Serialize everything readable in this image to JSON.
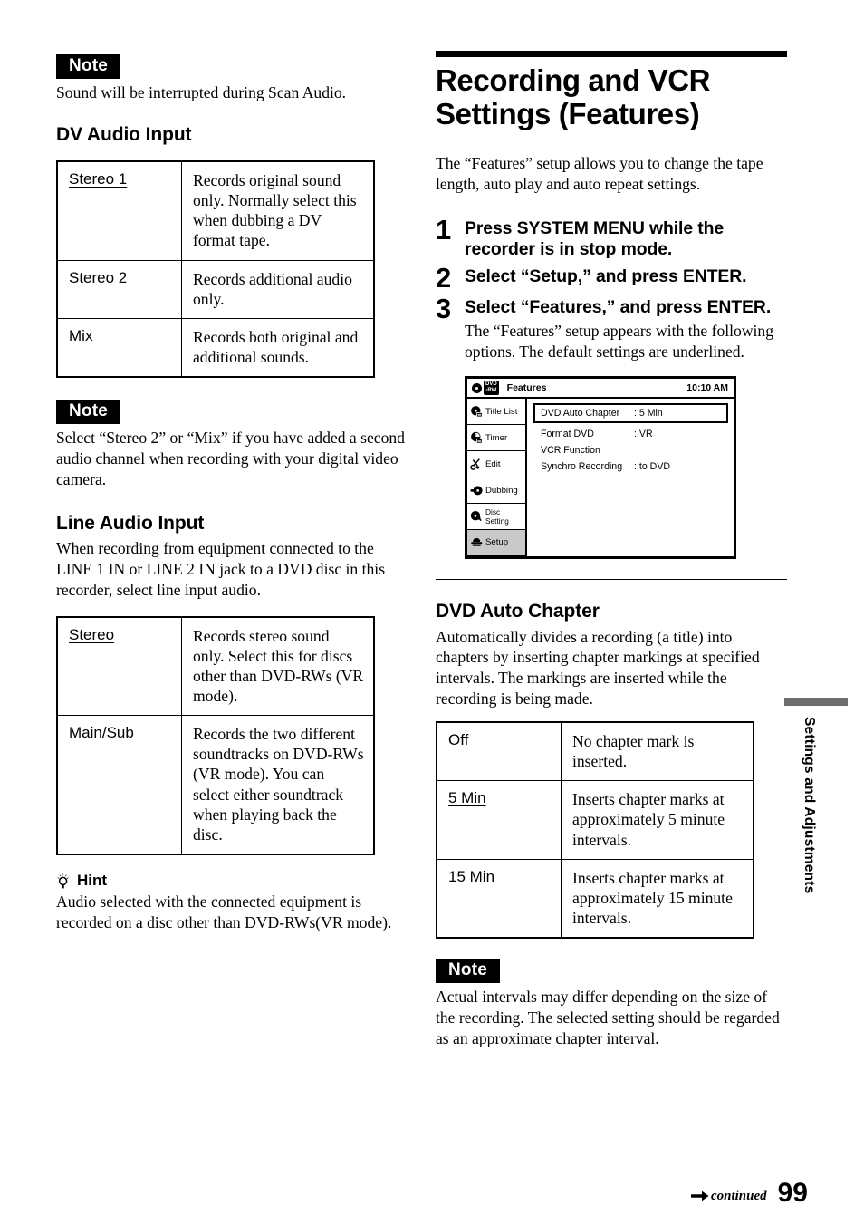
{
  "left": {
    "note1": {
      "badge": "Note",
      "text": "Sound will be interrupted during Scan Audio."
    },
    "dv_audio_input": {
      "heading": "DV Audio Input",
      "rows": [
        {
          "option": "Stereo 1",
          "underlined": true,
          "description": "Records original sound only. Normally select this when dubbing a DV format tape."
        },
        {
          "option": "Stereo 2",
          "underlined": false,
          "description": "Records additional audio only."
        },
        {
          "option": "Mix",
          "underlined": false,
          "description": "Records both original and additional sounds."
        }
      ]
    },
    "note2": {
      "badge": "Note",
      "text": "Select “Stereo 2” or “Mix” if you have added a second audio channel when recording with your digital video camera."
    },
    "line_audio_input": {
      "heading": "Line Audio Input",
      "intro": "When recording from equipment connected to the LINE 1 IN or LINE 2 IN jack to a DVD disc in this recorder, select line input audio.",
      "rows": [
        {
          "option": "Stereo",
          "underlined": true,
          "description": "Records stereo sound only. Select this for discs other than DVD-RWs (VR mode)."
        },
        {
          "option": "Main/Sub",
          "underlined": false,
          "description": "Records the two different soundtracks on DVD-RWs (VR mode). You can select either soundtrack when playing back the disc."
        }
      ]
    },
    "hint": {
      "label": "Hint",
      "text": "Audio selected with the connected equipment is recorded on a disc other than DVD-RWs(VR mode)."
    }
  },
  "right": {
    "title": "Recording and VCR Settings (Features)",
    "intro": "The “Features” setup allows you to change the tape length, auto play and auto repeat settings.",
    "steps": [
      {
        "num": "1",
        "title": "Press SYSTEM MENU while the recorder is in stop mode.",
        "desc": ""
      },
      {
        "num": "2",
        "title": "Select “Setup,” and press ENTER.",
        "desc": ""
      },
      {
        "num": "3",
        "title": "Select “Features,” and press ENTER.",
        "desc": "The “Features” setup appears with the following options. The default settings are underlined."
      }
    ],
    "osd": {
      "disc_badge_line1": "DVD",
      "disc_badge_line2": "-RW",
      "title": "Features",
      "clock": "10:10 AM",
      "sidebar": [
        {
          "label": "Title List",
          "icon": "title-list-icon",
          "selected": false
        },
        {
          "label": "Timer",
          "icon": "timer-icon",
          "selected": false
        },
        {
          "label": "Edit",
          "icon": "scissors-icon",
          "selected": false
        },
        {
          "label": "Dubbing",
          "icon": "dubbing-icon",
          "selected": false
        },
        {
          "label": "Disc Setting",
          "icon": "disc-setting-icon",
          "selected": false
        },
        {
          "label": "Setup",
          "icon": "setup-icon",
          "selected": true
        }
      ],
      "rows": [
        {
          "label": "DVD Auto Chapter",
          "value": ": 5 Min",
          "highlighted": true
        },
        {
          "label": "Format DVD",
          "value": ": VR",
          "highlighted": false
        },
        {
          "label": "VCR Function",
          "value": "",
          "highlighted": false
        },
        {
          "label": "Synchro Recording",
          "value": ": to DVD",
          "highlighted": false
        }
      ]
    },
    "dvd_auto_chapter": {
      "heading": "DVD Auto Chapter",
      "intro": "Automatically divides a recording (a title) into chapters by inserting chapter markings at specified intervals. The markings are inserted while the recording is being made.",
      "rows": [
        {
          "option": "Off",
          "underlined": false,
          "description": "No chapter mark is inserted."
        },
        {
          "option": "5 Min",
          "underlined": true,
          "description": "Inserts chapter marks at approximately 5 minute intervals."
        },
        {
          "option": "15 Min",
          "underlined": false,
          "description": "Inserts chapter marks at approximately 15 minute intervals."
        }
      ]
    },
    "note3": {
      "badge": "Note",
      "text": "Actual intervals may differ depending on the size of the recording. The selected setting should be regarded as an approximate chapter interval."
    }
  },
  "side_tab": {
    "label": "Settings and Adjustments",
    "bar_color": "#6e6e6e"
  },
  "footer": {
    "continued": "continued",
    "page_number": "99"
  }
}
